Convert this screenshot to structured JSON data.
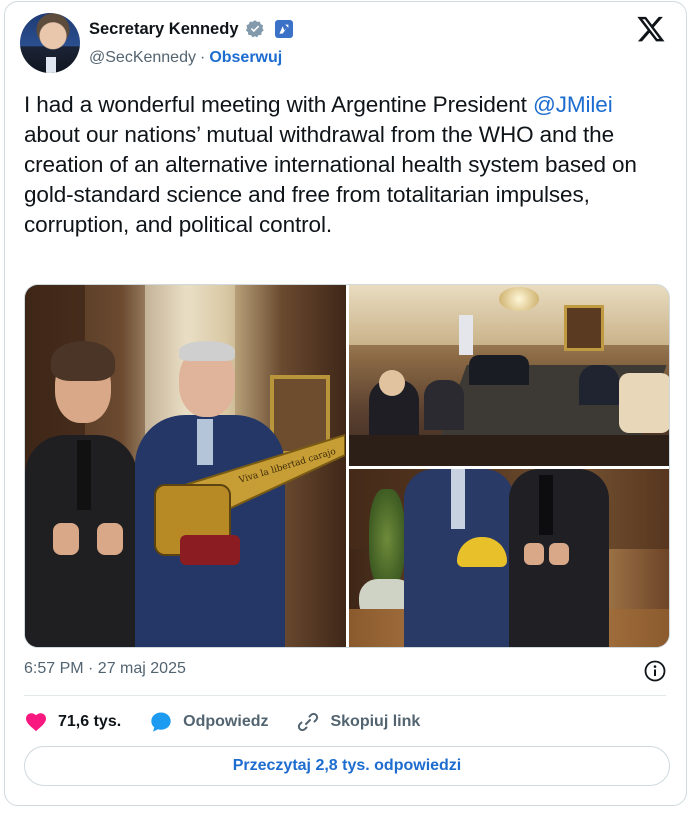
{
  "author": {
    "display_name": "Secretary Kennedy",
    "handle": "@SecKennedy",
    "separator": "·",
    "follow_label": "Obserwuj"
  },
  "tweet": {
    "text_before_mention": "I had a wonderful meeting with Argentine President ",
    "mention": "@JMilei",
    "text_after_mention": " about our nations’ mutual withdrawal from the WHO and the creation of an alternative international health system based on gold-standard science and free from totalitarian impulses, corruption, and political control.",
    "timestamp": "6:57 PM · 27 maj 2025"
  },
  "media": {
    "chainsaw_engraving": "Viva la libertad carajo"
  },
  "actions": {
    "like_count": "71,6 tys.",
    "reply_label": "Odpowiedz",
    "copy_link_label": "Skopiuj link"
  },
  "replies_button": "Przeczytaj 2,8 tys. odpowiedzi",
  "colors": {
    "accent": "#1d6ccf",
    "like": "#f91880",
    "muted_text": "#536471",
    "border": "#cfd9de"
  },
  "icons": [
    "verified-badge-icon",
    "government-badge-icon",
    "x-logo-icon",
    "info-icon",
    "heart-icon",
    "reply-bubble-icon",
    "link-icon"
  ]
}
